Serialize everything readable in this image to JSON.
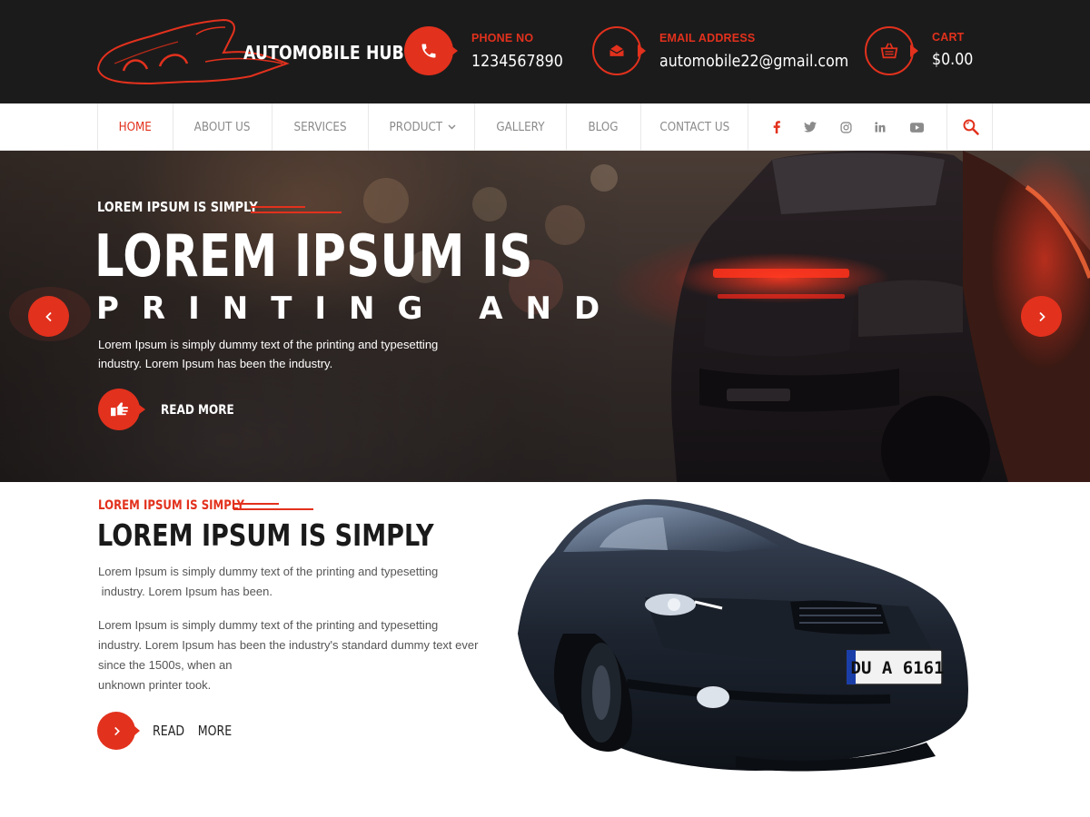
{
  "brand": {
    "name": "AUTOMOBILE HUB"
  },
  "header": {
    "phone": {
      "label": "PHONE NO",
      "value": "1234567890",
      "icon": "phone-icon"
    },
    "email": {
      "label": "EMAIL ADDRESS",
      "value": "automobile22@gmail.com",
      "icon": "envelope-icon"
    },
    "cart": {
      "label": "CART",
      "value": "$0.00",
      "icon": "basket-icon"
    }
  },
  "nav": {
    "items": [
      {
        "label": "HOME",
        "active": true
      },
      {
        "label": "ABOUT US"
      },
      {
        "label": "SERVICES"
      },
      {
        "label": "PRODUCT",
        "has_dropdown": true
      },
      {
        "label": "GALLERY"
      },
      {
        "label": "BLOG"
      },
      {
        "label": "CONTACT US"
      }
    ],
    "social": [
      "facebook-icon",
      "twitter-icon",
      "instagram-icon",
      "linkedin-icon",
      "youtube-icon"
    ],
    "search_icon": "search-icon"
  },
  "hero": {
    "kicker": "LOREM IPSUM IS SIMPLY",
    "title": "LOREM IPSUM IS",
    "subtitle": "PRINTING AND",
    "description": "Lorem Ipsum is simply dummy text of the printing and typesetting industry. Lorem Ipsum has been the industry.",
    "cta": "READ MORE",
    "cta_icon": "pointing-hand-icon",
    "prev_icon": "chevron-left-icon",
    "next_icon": "chevron-right-icon"
  },
  "about": {
    "kicker": "LOREM IPSUM IS SIMPLY",
    "title": "LOREM IPSUM IS SIMPLY",
    "p1_line1": "Lorem Ipsum is simply dummy text of the printing and typesetting",
    "p1_line2": " industry. Lorem Ipsum has been.",
    "p2_line1": "Lorem Ipsum is simply dummy text of the printing and typesetting",
    "p2_line2": "industry. Lorem Ipsum has been the industry's standard dummy text ever",
    "p2_line3": "since the 1500s, when an",
    "p2_line4": "unknown printer took.",
    "cta": "READ  MORE",
    "plate": "DU A 6161"
  },
  "colors": {
    "accent": "#e2311d",
    "header_bg": "#1b1b1b"
  }
}
